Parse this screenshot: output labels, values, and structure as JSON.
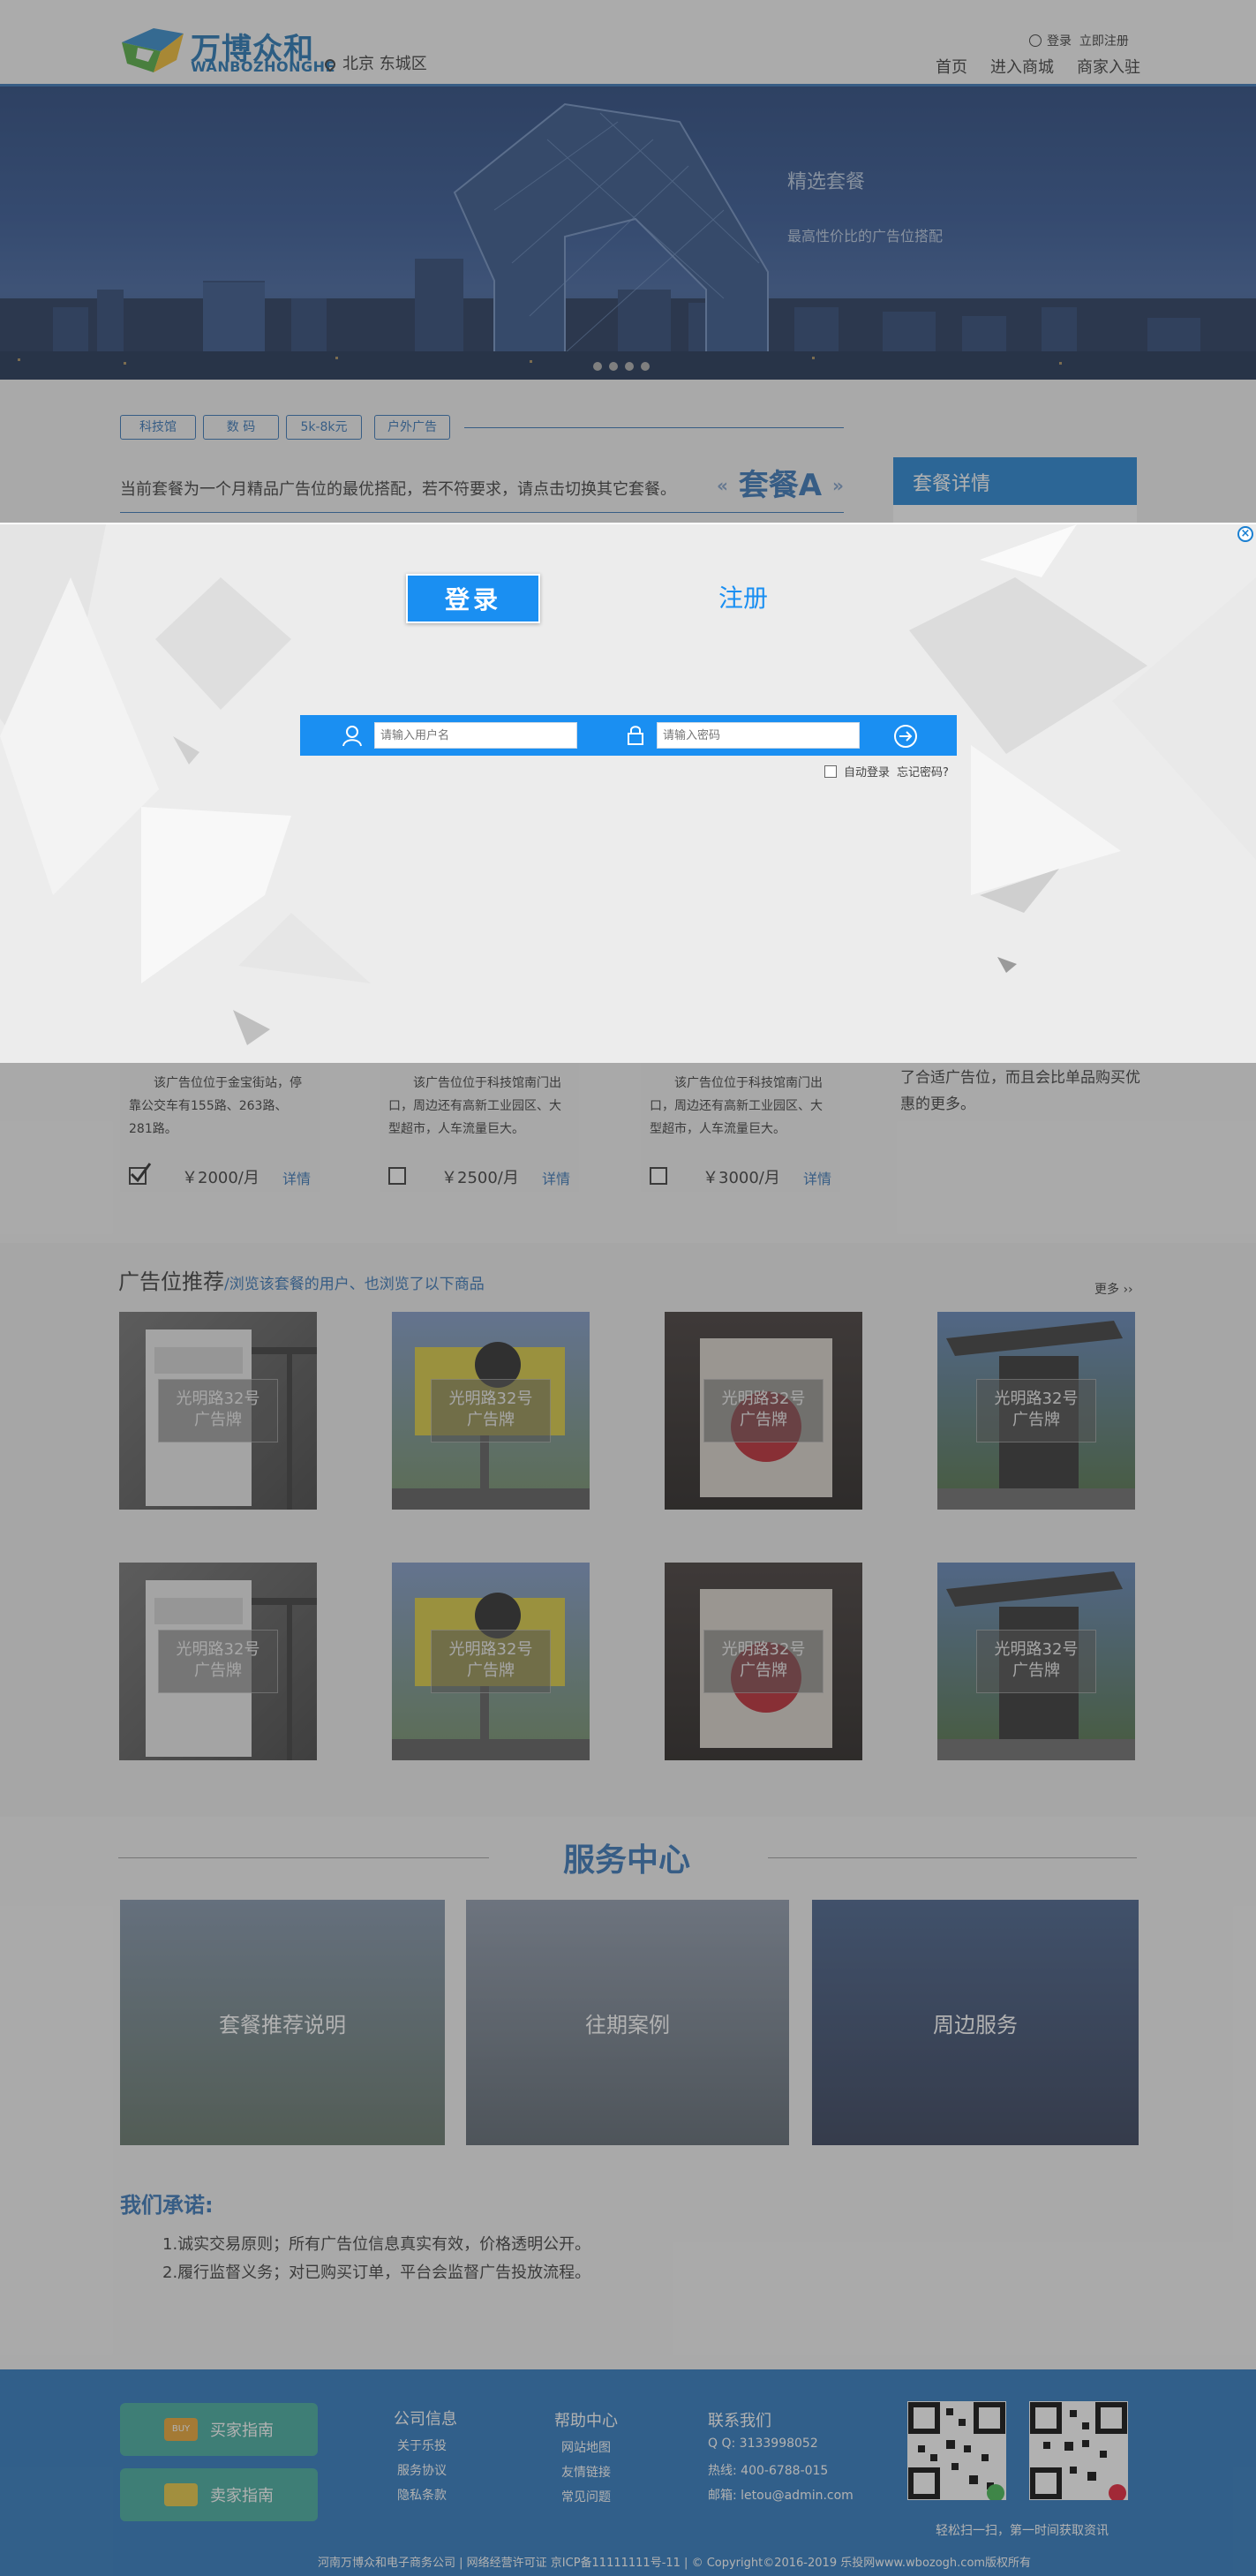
{
  "header": {
    "logo_cn": "万博众和",
    "logo_en": "WANBOZHONGHE",
    "location": "北京  东城区",
    "login_link": "登录",
    "register_link": "立即注册",
    "nav": [
      "首页",
      "进入商城",
      "商家入驻"
    ]
  },
  "hero": {
    "title": "精选套餐",
    "subtitle": "最高性价比的广告位搭配"
  },
  "filters": {
    "tags": [
      "科技馆",
      "数  码",
      "5k-8k元",
      "户外广告"
    ]
  },
  "package": {
    "description": "当前套餐为一个月精品广告位的最优搭配，若不符要求，请点击切换其它套餐。",
    "name": "套餐A",
    "prev": "«",
    "next": "»",
    "detail_title": "套餐详情",
    "cards": [
      {
        "text": "该广告位位于金宝街站，停靠公交车有155路、263路、281路。",
        "price": "￥2000/月",
        "link": "详情",
        "checked": true
      },
      {
        "text": "该广告位位于科技馆南门出口，周边还有高新工业园区、大型超市，人车流量巨大。",
        "price": "￥2500/月",
        "link": "详情",
        "checked": false
      },
      {
        "text": "该广告位位于科技馆南门出口，周边还有高新工业园区、大型超市，人车流量巨大。",
        "price": "￥3000/月",
        "link": "详情",
        "checked": false
      }
    ],
    "detail_text": "了合适广告位，而且会比单品购买优惠的更多。"
  },
  "recommend": {
    "title": "广告位推荐",
    "subtitle": "/浏览该套餐的用户、也浏览了以下商品",
    "more": "更多 ››",
    "items": [
      {
        "line1": "光明路32号",
        "line2": "广告牌"
      },
      {
        "line1": "光明路32号",
        "line2": "广告牌"
      },
      {
        "line1": "光明路32号",
        "line2": "广告牌"
      },
      {
        "line1": "光明路32号",
        "line2": "广告牌"
      },
      {
        "line1": "光明路32号",
        "line2": "广告牌"
      },
      {
        "line1": "光明路32号",
        "line2": "广告牌"
      },
      {
        "line1": "光明路32号",
        "line2": "广告牌"
      },
      {
        "line1": "光明路32号",
        "line2": "广告牌"
      }
    ]
  },
  "service": {
    "title": "服务中心",
    "cards": [
      "套餐推荐说明",
      "往期案例",
      "周边服务"
    ],
    "promise_title": "我们承诺:",
    "promises": [
      "1.诚实交易原则；所有广告位信息真实有效，价格透明公开。",
      "2.履行监督义务；对已购买订单，平台会监督广告投放流程。"
    ]
  },
  "footer": {
    "buyer_guide": "买家指南",
    "seller_guide": "卖家指南",
    "buy_icon_text": "BUY",
    "columns": [
      {
        "title": "公司信息",
        "items": [
          "关于乐投",
          "服务协议",
          "隐私条款"
        ]
      },
      {
        "title": "帮助中心",
        "items": [
          "网站地图",
          "友情链接",
          "常见问题"
        ]
      },
      {
        "title": "联系我们",
        "items": [
          "Q Q:  3133998052",
          "热线:  400-6788-015",
          "邮箱:  letou@admin.com"
        ]
      }
    ],
    "qr_caption": "轻松扫一扫，第一时间获取资讯",
    "copyright": "河南万博众和电子商务公司 | 网络经营许可证 京ICP备11111111号-11 | © Copyright©2016-2019  乐投网www.wbozogh.com版权所有"
  },
  "modal": {
    "close": "×",
    "tab_login": "登录",
    "tab_register": "注册",
    "username_placeholder": "请输入用户名",
    "password_placeholder": "请输入密码",
    "auto_login": "自动登录",
    "forgot": "忘记密码?"
  },
  "colors": {
    "accent": "#1a8ff2",
    "brand": "#2d6fb4",
    "footer": "#2373bc",
    "guide_button": "#3aa89a"
  }
}
